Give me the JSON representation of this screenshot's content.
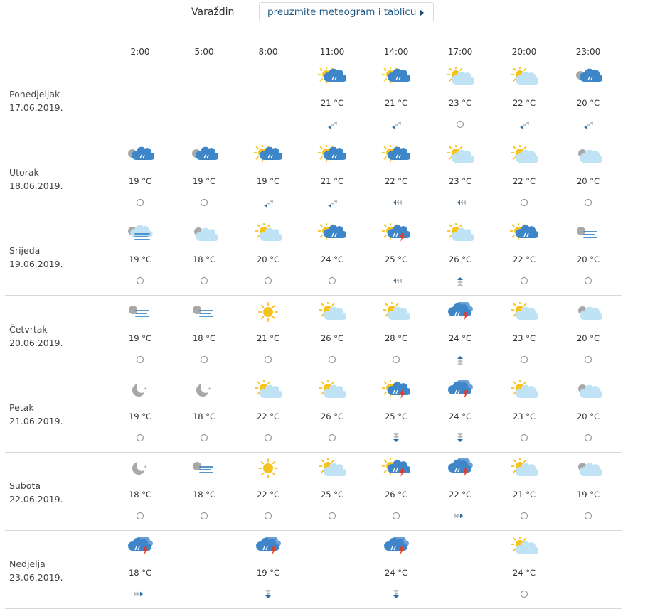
{
  "header": {
    "city": "Varaždin",
    "download_label": "preuzmite meteogram i tablicu"
  },
  "hours": [
    "2:00",
    "5:00",
    "8:00",
    "11:00",
    "14:00",
    "17:00",
    "20:00",
    "23:00"
  ],
  "days": [
    {
      "name": "Ponedjeljak",
      "date": "17.06.2019.",
      "cells": [
        null,
        null,
        null,
        {
          "icon": "sun-cloud-rain",
          "temp": "21 °C",
          "wind": "w-sw"
        },
        {
          "icon": "sun-cloud-rain",
          "temp": "21 °C",
          "wind": "w-sw"
        },
        {
          "icon": "sun-cloud",
          "temp": "23 °C",
          "wind": "calm"
        },
        {
          "icon": "sun-cloud",
          "temp": "22 °C",
          "wind": "w-sw"
        },
        {
          "icon": "moon-cloud-rain",
          "temp": "20 °C",
          "wind": "w-sw"
        }
      ]
    },
    {
      "name": "Utorak",
      "date": "18.06.2019.",
      "cells": [
        {
          "icon": "moon-cloud-rain",
          "temp": "19 °C",
          "wind": "calm"
        },
        {
          "icon": "moon-cloud-rain",
          "temp": "19 °C",
          "wind": "calm"
        },
        {
          "icon": "sun-cloud-rain",
          "temp": "19 °C",
          "wind": "w-sw"
        },
        {
          "icon": "sun-cloud-rain",
          "temp": "21 °C",
          "wind": "w-sw"
        },
        {
          "icon": "sun-cloud-rain",
          "temp": "22 °C",
          "wind": "w"
        },
        {
          "icon": "sun-cloud",
          "temp": "23 °C",
          "wind": "w"
        },
        {
          "icon": "sun-cloud",
          "temp": "22 °C",
          "wind": "calm"
        },
        {
          "icon": "moon-cloud",
          "temp": "20 °C",
          "wind": "calm"
        }
      ]
    },
    {
      "name": "Srijeda",
      "date": "19.06.2019.",
      "cells": [
        {
          "icon": "moon-cloud-fog",
          "temp": "19 °C",
          "wind": "calm"
        },
        {
          "icon": "moon-cloud",
          "temp": "18 °C",
          "wind": "calm"
        },
        {
          "icon": "sun-cloud",
          "temp": "20 °C",
          "wind": "calm"
        },
        {
          "icon": "sun-cloud-rain",
          "temp": "24 °C",
          "wind": "calm"
        },
        {
          "icon": "sun-cloud-storm",
          "temp": "25 °C",
          "wind": "w"
        },
        {
          "icon": "sun-cloud",
          "temp": "26 °C",
          "wind": "n"
        },
        {
          "icon": "sun-cloud-rain",
          "temp": "22 °C",
          "wind": "calm"
        },
        {
          "icon": "moon-fog",
          "temp": "20 °C",
          "wind": "calm"
        }
      ]
    },
    {
      "name": "Četvrtak",
      "date": "20.06.2019.",
      "cells": [
        {
          "icon": "moon-fog",
          "temp": "19 °C",
          "wind": "calm"
        },
        {
          "icon": "moon-fog",
          "temp": "18 °C",
          "wind": "calm"
        },
        {
          "icon": "sun",
          "temp": "21 °C",
          "wind": "calm"
        },
        {
          "icon": "sun-cloud",
          "temp": "26 °C",
          "wind": "calm"
        },
        {
          "icon": "sun-cloud",
          "temp": "28 °C",
          "wind": "calm"
        },
        {
          "icon": "cloud-storm",
          "temp": "24 °C",
          "wind": "n"
        },
        {
          "icon": "sun-cloud",
          "temp": "23 °C",
          "wind": "calm"
        },
        {
          "icon": "moon-cloud",
          "temp": "20 °C",
          "wind": "calm"
        }
      ]
    },
    {
      "name": "Petak",
      "date": "21.06.2019.",
      "cells": [
        {
          "icon": "moon",
          "temp": "19 °C",
          "wind": "calm"
        },
        {
          "icon": "moon",
          "temp": "18 °C",
          "wind": "calm"
        },
        {
          "icon": "sun-cloud",
          "temp": "22 °C",
          "wind": "calm"
        },
        {
          "icon": "sun-cloud",
          "temp": "26 °C",
          "wind": "calm"
        },
        {
          "icon": "sun-cloud-storm",
          "temp": "25 °C",
          "wind": "s"
        },
        {
          "icon": "cloud-storm",
          "temp": "24 °C",
          "wind": "s"
        },
        {
          "icon": "sun-cloud",
          "temp": "23 °C",
          "wind": "calm"
        },
        {
          "icon": "moon-cloud",
          "temp": "20 °C",
          "wind": "calm"
        }
      ]
    },
    {
      "name": "Subota",
      "date": "22.06.2019.",
      "cells": [
        {
          "icon": "moon",
          "temp": "18 °C",
          "wind": "calm"
        },
        {
          "icon": "moon-fog",
          "temp": "18 °C",
          "wind": "calm"
        },
        {
          "icon": "sun",
          "temp": "22 °C",
          "wind": "calm"
        },
        {
          "icon": "sun-cloud",
          "temp": "25 °C",
          "wind": "calm"
        },
        {
          "icon": "sun-cloud-storm",
          "temp": "26 °C",
          "wind": "calm"
        },
        {
          "icon": "cloud-storm",
          "temp": "22 °C",
          "wind": "e"
        },
        {
          "icon": "sun-cloud",
          "temp": "21 °C",
          "wind": "calm"
        },
        {
          "icon": "moon-cloud",
          "temp": "19 °C",
          "wind": "calm"
        }
      ]
    },
    {
      "name": "Nedjelja",
      "date": "23.06.2019.",
      "cells": [
        {
          "icon": "cloud-storm",
          "temp": "18 °C",
          "wind": "e"
        },
        null,
        {
          "icon": "cloud-storm",
          "temp": "19 °C",
          "wind": "s"
        },
        null,
        {
          "icon": "cloud-storm",
          "temp": "24 °C",
          "wind": "s"
        },
        null,
        {
          "icon": "sun-cloud",
          "temp": "24 °C",
          "wind": "calm"
        },
        null
      ]
    }
  ],
  "colors": {
    "sun": "#f6c21c",
    "cloud_light": "#bfe2f4",
    "cloud_dark": "#3f86c9",
    "storm": "#e23b2a",
    "gray": "#a8a8a8",
    "link": "#1f5b86",
    "wind_blue": "#2a6fa8",
    "wind_gray": "#bfbfbf"
  }
}
